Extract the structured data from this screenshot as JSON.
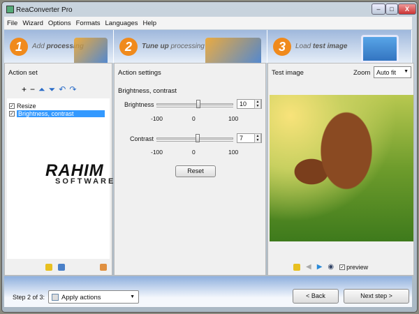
{
  "window": {
    "title": "ReaConverter Pro",
    "min": "–",
    "max": "□",
    "close": "X"
  },
  "menu": [
    "File",
    "Wizard",
    "Options",
    "Formats",
    "Languages",
    "Help"
  ],
  "steps": [
    {
      "num": "1",
      "pre": "Add ",
      "bold": "processing",
      "post": ""
    },
    {
      "num": "2",
      "pre": "",
      "bold": "Tune up",
      "post": " processing"
    },
    {
      "num": "3",
      "pre": "Load ",
      "bold": "test image",
      "post": ""
    }
  ],
  "action_set": {
    "title": "Action set",
    "items": [
      {
        "label": "Resize",
        "checked": true,
        "selected": false
      },
      {
        "label": "Brightness, contrast",
        "checked": true,
        "selected": true
      }
    ]
  },
  "watermark": {
    "line1": "RAHIM",
    "line2": "SOFTWARE"
  },
  "settings": {
    "title": "Action settings",
    "group": "Brightness, contrast",
    "brightness": {
      "label": "Brightness",
      "value": "10",
      "min": "-100",
      "mid": "0",
      "max": "100",
      "fraction": 0.55
    },
    "contrast": {
      "label": "Contrast",
      "value": "7",
      "min": "-100",
      "mid": "0",
      "max": "100",
      "fraction": 0.535
    },
    "reset": "Reset"
  },
  "test_image": {
    "title": "Test image",
    "zoom_label": "Zoom",
    "zoom_value": "Auto fit",
    "preview": "preview"
  },
  "footer": {
    "step_label": "Step 2 of 3:",
    "action_value": "Apply actions",
    "back": "< Back",
    "next": "Next step >"
  }
}
